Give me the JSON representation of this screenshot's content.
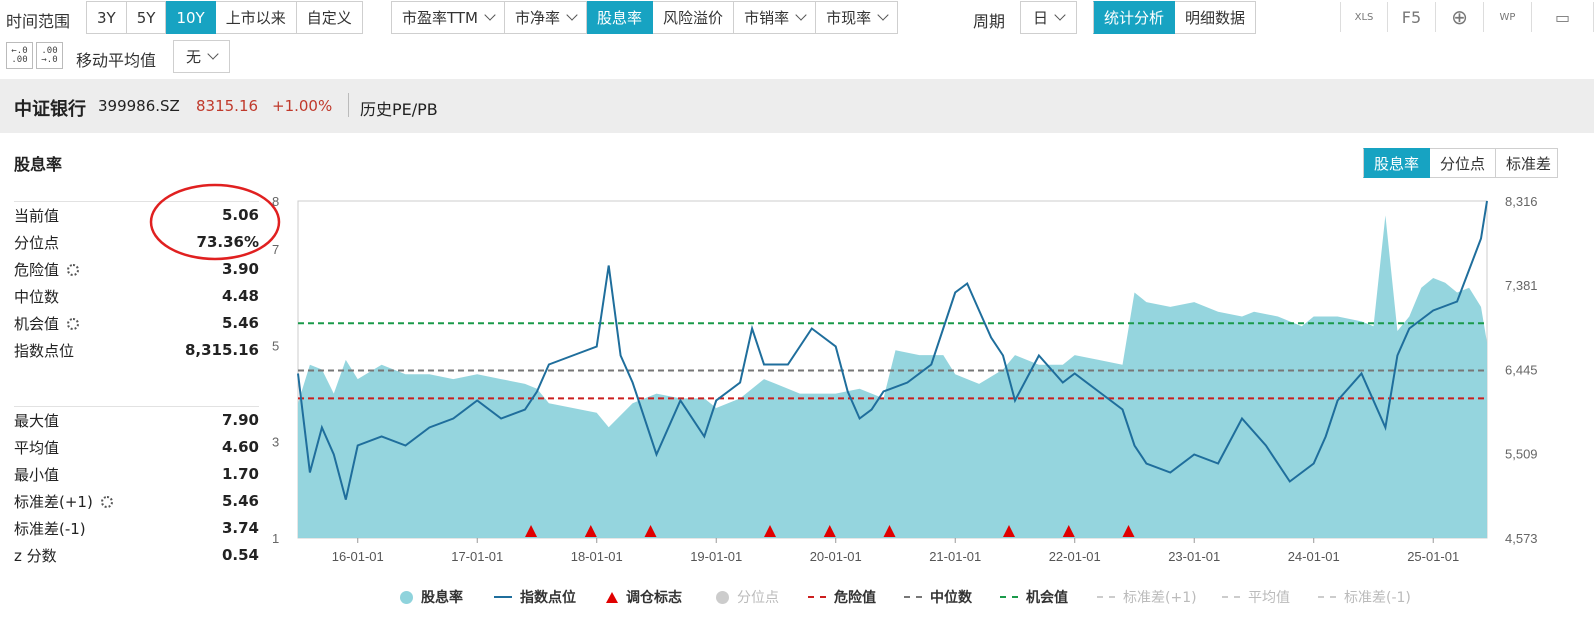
{
  "toolbar": {
    "range_label": "时间范围",
    "range_buttons": [
      "3Y",
      "5Y",
      "10Y",
      "上市以来",
      "自定义"
    ],
    "metric_buttons": [
      "市盈率TTM",
      "市净率",
      "股息率",
      "风险溢价",
      "市销率",
      "市现率"
    ],
    "period_label": "周期",
    "period_value": "日",
    "view_buttons": [
      "统计分析",
      "明细数据"
    ],
    "tool_icons": [
      "XLS",
      "F5",
      "⊕",
      "WP",
      "▭"
    ],
    "ma_label": "移动平均值",
    "ma_value": "无",
    "decimal_icons": [
      "←.0\n.00",
      ".00\n→.0"
    ]
  },
  "header": {
    "name": "中证银行",
    "code": "399986.SZ",
    "price": "8315.16",
    "change": "+1.00%",
    "subtitle": "历史PE/PB"
  },
  "panel": {
    "title": "股息率",
    "tabs": [
      "股息率",
      "分位点",
      "标准差"
    ],
    "stats_top": [
      {
        "label": "当前值",
        "value": "5.06",
        "gear": false
      },
      {
        "label": "分位点",
        "value": "73.36%",
        "gear": false
      },
      {
        "label": "危险值",
        "value": "3.90",
        "gear": true
      },
      {
        "label": "中位数",
        "value": "4.48",
        "gear": false
      },
      {
        "label": "机会值",
        "value": "5.46",
        "gear": true
      },
      {
        "label": "指数点位",
        "value": "8,315.16",
        "gear": false
      }
    ],
    "stats_bottom": [
      {
        "label": "最大值",
        "value": "7.90",
        "gear": false
      },
      {
        "label": "平均值",
        "value": "4.60",
        "gear": false
      },
      {
        "label": "最小值",
        "value": "1.70",
        "gear": false
      },
      {
        "label": "标准差(+1)",
        "value": "5.46",
        "gear": true
      },
      {
        "label": "标准差(-1)",
        "value": "3.74",
        "gear": false
      },
      {
        "label": "z 分数",
        "value": "0.54",
        "gear": false
      }
    ]
  },
  "colors": {
    "accent": "#17a3c2",
    "area_fill": "#8fd3dc",
    "index_line": "#1f6e9c",
    "danger": "#cc1f1f",
    "median": "#777777",
    "opportunity": "#1a9a4a",
    "marker": "#e00000",
    "up": "#c0392b"
  },
  "chart_data": {
    "type": "area",
    "x_ticks": [
      "16-01-01",
      "17-01-01",
      "18-01-01",
      "19-01-01",
      "20-01-01",
      "21-01-01",
      "22-01-01",
      "23-01-01",
      "24-01-01",
      "25-01-01"
    ],
    "x_range": [
      2015.5,
      2025.45
    ],
    "y_left_ticks": [
      "1",
      "3",
      "5",
      "7",
      "8"
    ],
    "y_left_range": [
      1,
      8
    ],
    "y_right_ticks": [
      "4,573",
      "5,509",
      "6,445",
      "7,381",
      "8,316"
    ],
    "y_right_range": [
      4573,
      8316
    ],
    "reference_lines": {
      "danger": 3.9,
      "median": 4.48,
      "opportunity": 5.46
    },
    "series": [
      {
        "name": "股息率",
        "x": [
          2015.5,
          2015.6,
          2015.7,
          2015.8,
          2015.9,
          2016.0,
          2016.2,
          2016.4,
          2016.6,
          2016.8,
          2017.0,
          2017.2,
          2017.4,
          2017.5,
          2017.6,
          2017.8,
          2018.0,
          2018.1,
          2018.3,
          2018.5,
          2018.7,
          2018.9,
          2019.0,
          2019.2,
          2019.4,
          2019.5,
          2019.7,
          2019.9,
          2020.0,
          2020.2,
          2020.4,
          2020.5,
          2020.7,
          2020.9,
          2021.0,
          2021.2,
          2021.4,
          2021.5,
          2021.7,
          2021.9,
          2022.0,
          2022.2,
          2022.4,
          2022.5,
          2022.6,
          2022.8,
          2023.0,
          2023.2,
          2023.4,
          2023.5,
          2023.7,
          2023.9,
          2024.0,
          2024.2,
          2024.4,
          2024.5,
          2024.6,
          2024.7,
          2024.8,
          2024.9,
          2025.0,
          2025.1,
          2025.2,
          2025.3,
          2025.4,
          2025.45
        ],
        "values": [
          3.8,
          4.6,
          4.5,
          4.0,
          4.7,
          4.3,
          4.6,
          4.4,
          4.4,
          4.3,
          4.4,
          4.3,
          4.2,
          4.1,
          3.8,
          3.7,
          3.6,
          3.3,
          3.8,
          4.0,
          3.9,
          3.9,
          3.7,
          3.9,
          4.3,
          4.2,
          4.0,
          4.0,
          4.0,
          4.1,
          3.9,
          4.9,
          4.8,
          4.8,
          4.4,
          4.2,
          4.5,
          4.8,
          4.6,
          4.6,
          4.8,
          4.7,
          4.6,
          6.1,
          5.9,
          5.8,
          5.9,
          5.7,
          5.6,
          5.7,
          5.6,
          5.4,
          5.6,
          5.6,
          5.5,
          5.4,
          7.7,
          5.3,
          5.6,
          6.2,
          6.4,
          6.3,
          6.1,
          6.2,
          5.8,
          5.06
        ]
      },
      {
        "name": "指数点位",
        "x": [
          2015.5,
          2015.6,
          2015.7,
          2015.8,
          2015.9,
          2016.0,
          2016.2,
          2016.4,
          2016.6,
          2016.8,
          2017.0,
          2017.2,
          2017.4,
          2017.5,
          2017.6,
          2017.8,
          2018.0,
          2018.1,
          2018.2,
          2018.3,
          2018.5,
          2018.7,
          2018.9,
          2019.0,
          2019.2,
          2019.3,
          2019.4,
          2019.6,
          2019.8,
          2020.0,
          2020.1,
          2020.2,
          2020.3,
          2020.4,
          2020.6,
          2020.8,
          2021.0,
          2021.1,
          2021.2,
          2021.3,
          2021.4,
          2021.5,
          2021.7,
          2021.9,
          2022.0,
          2022.2,
          2022.4,
          2022.5,
          2022.6,
          2022.8,
          2023.0,
          2023.2,
          2023.4,
          2023.6,
          2023.8,
          2024.0,
          2024.1,
          2024.2,
          2024.4,
          2024.6,
          2024.7,
          2024.8,
          2024.9,
          2025.0,
          2025.2,
          2025.4,
          2025.45
        ],
        "values": [
          6400,
          5300,
          5800,
          5500,
          5000,
          5600,
          5700,
          5600,
          5800,
          5900,
          6100,
          5900,
          6000,
          6200,
          6500,
          6600,
          6700,
          7600,
          6600,
          6300,
          5500,
          6100,
          5700,
          6100,
          6300,
          6900,
          6500,
          6500,
          6900,
          6700,
          6200,
          5900,
          6000,
          6200,
          6300,
          6500,
          7300,
          7400,
          7100,
          6800,
          6600,
          6100,
          6600,
          6300,
          6400,
          6200,
          6000,
          5600,
          5400,
          5300,
          5500,
          5400,
          5900,
          5600,
          5200,
          5400,
          5700,
          6100,
          6400,
          5800,
          6600,
          6900,
          7000,
          7100,
          7200,
          7900,
          8316
        ]
      },
      {
        "name": "调仓标志",
        "x": [
          2017.45,
          2017.95,
          2018.45,
          2019.45,
          2019.95,
          2020.45,
          2021.45,
          2021.95,
          2022.45
        ],
        "values": [
          1,
          1,
          1,
          1,
          1,
          1,
          1,
          1,
          1
        ]
      }
    ],
    "legend": [
      "股息率",
      "指数点位",
      "调仓标志",
      "分位点",
      "危险值",
      "中位数",
      "机会值",
      "标准差(+1)",
      "平均值",
      "标准差(-1)"
    ],
    "legend_placement": "bottom"
  }
}
